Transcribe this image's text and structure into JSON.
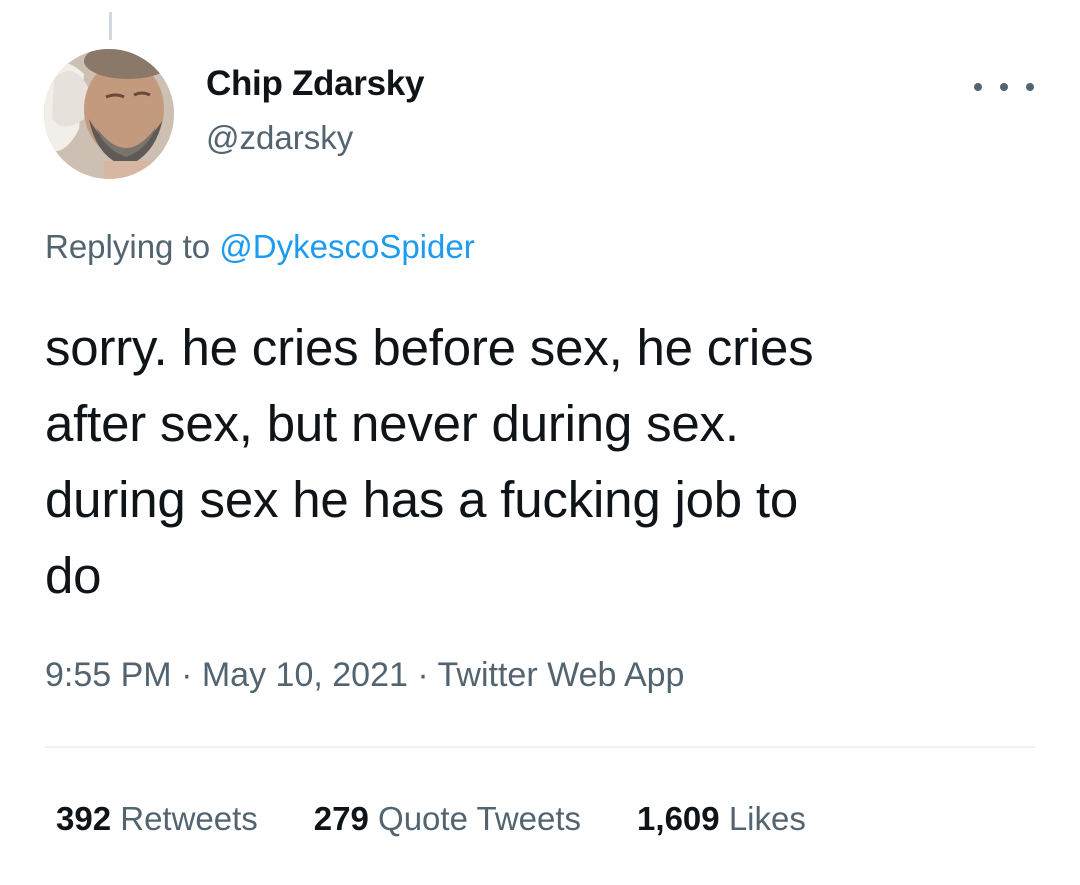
{
  "tweet": {
    "author": {
      "name": "Chip Zdarsky",
      "handle": "@zdarsky"
    },
    "replying_to_label": "Replying to",
    "replying_to_handle": "@DykescoSpider",
    "text": "sorry. he cries before sex, he cries\nafter sex, but never during sex.\nduring sex he has a fucking job to\ndo",
    "time": "9:55 PM",
    "separator": "·",
    "date": "May 10, 2021",
    "source": "Twitter Web App"
  },
  "stats": {
    "retweets_count": "392",
    "retweets_label": "Retweets",
    "quotes_count": "279",
    "quotes_label": "Quote Tweets",
    "likes_count": "1,609",
    "likes_label": "Likes"
  },
  "colors": {
    "text_primary": "#0f1419",
    "text_secondary": "#536471",
    "link": "#1d9bf0",
    "divider": "#eff3f4"
  },
  "icons": {
    "more": "more-horizontal-icon"
  }
}
